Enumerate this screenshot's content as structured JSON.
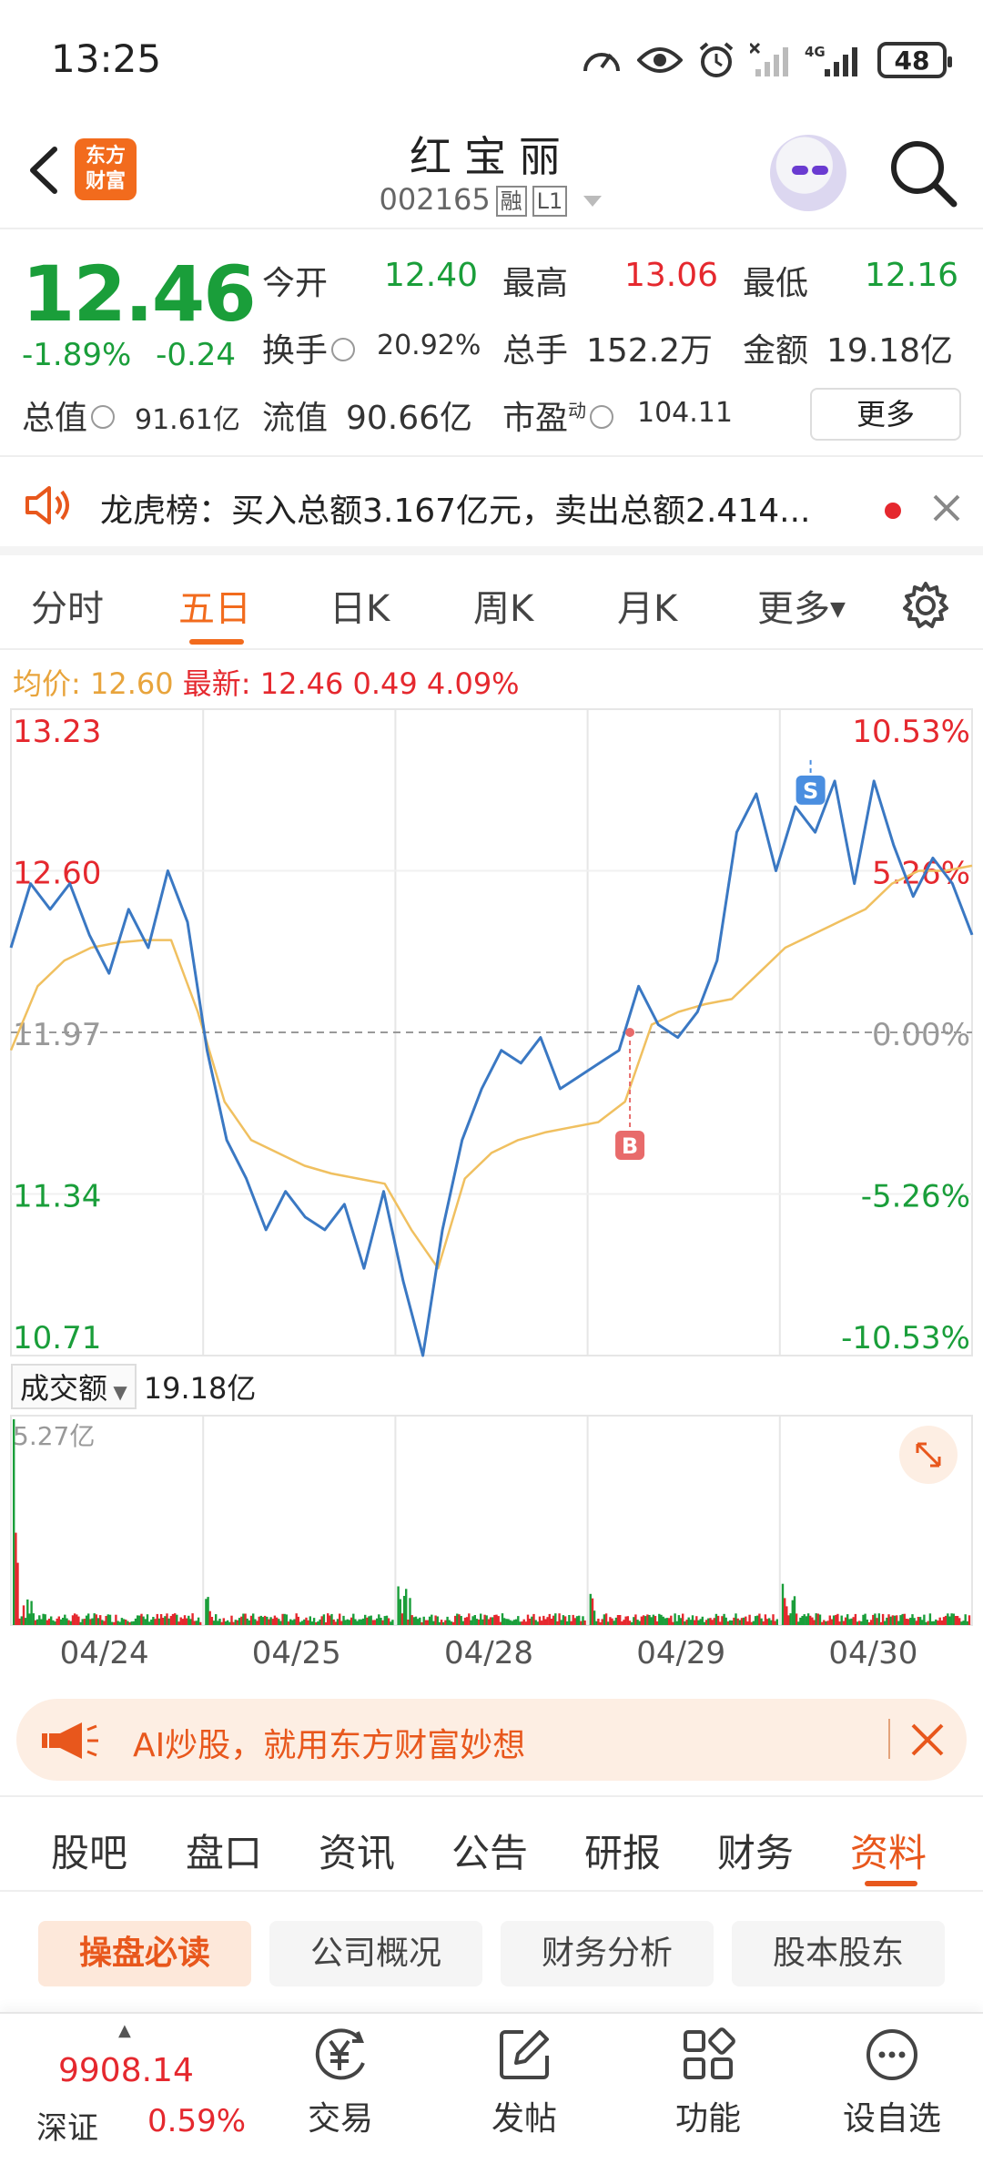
{
  "status_bar": {
    "time": "13:25",
    "battery": "48",
    "network": "4G"
  },
  "header": {
    "stock_name": "红宝丽",
    "stock_code": "002165",
    "tag_margin": "融",
    "tag_level": "L1",
    "logo_line1": "东方",
    "logo_line2": "财富"
  },
  "quote": {
    "price": "12.46",
    "change_pct": "-1.89%",
    "change": "-0.24",
    "open_label": "今开",
    "open": "12.40",
    "high_label": "最高",
    "high": "13.06",
    "low_label": "最低",
    "low": "12.16",
    "turnover_label": "换手",
    "turnover": "20.92%",
    "volume_label": "总手",
    "volume": "152.2万",
    "amount_label": "金额",
    "amount": "19.18亿",
    "mcap_label": "总值",
    "mcap": "91.61亿",
    "float_label": "流值",
    "float_cap": "90.66亿",
    "pe_label": "市盈",
    "pe_sup": "动",
    "pe": "104.11",
    "more": "更多"
  },
  "notice": {
    "text": "龙虎榜：买入总额3.167亿元，卖出总额2.414..."
  },
  "chart_tabs": [
    "分时",
    "五日",
    "日K",
    "周K",
    "月K",
    "更多"
  ],
  "chart_header": {
    "avg_label": "均价:",
    "avg": "12.60",
    "latest_label": "最新:",
    "latest": "12.46",
    "diff": "0.49",
    "diff_pct": "4.09%"
  },
  "chart_data": {
    "type": "line",
    "title": "",
    "xlabel": "",
    "ylabel": "",
    "categories": [
      "04/24",
      "04/25",
      "04/28",
      "04/29",
      "04/30"
    ],
    "y_left_ticks": [
      "13.23",
      "12.60",
      "11.97",
      "11.34",
      "10.71"
    ],
    "y_right_ticks": [
      "10.53%",
      "5.26%",
      "0.00%",
      "-5.26%",
      "-10.53%"
    ],
    "ylim": [
      10.71,
      13.23
    ],
    "prev_close": 11.97,
    "series": [
      {
        "values": [
          12.3,
          12.55,
          12.45,
          12.55,
          12.35,
          12.2,
          12.45,
          12.3,
          12.6,
          12.4,
          11.9,
          11.55,
          11.4,
          11.2,
          11.35,
          11.25,
          11.2,
          11.3,
          11.05,
          11.35,
          11.0,
          10.71,
          11.2,
          11.55,
          11.75,
          11.9,
          11.85,
          11.95,
          11.75,
          11.8,
          11.85,
          11.9,
          12.15,
          12.0,
          11.95,
          12.05,
          12.25,
          12.75,
          12.9,
          12.6,
          12.85,
          12.75,
          12.95,
          12.55,
          12.95,
          12.7,
          12.5,
          12.65,
          12.55,
          12.35
        ]
      },
      {
        "values": [
          11.9,
          12.15,
          12.25,
          12.3,
          12.32,
          12.33,
          12.33,
          12.05,
          11.7,
          11.55,
          11.5,
          11.45,
          11.42,
          11.4,
          11.38,
          11.2,
          11.05,
          11.4,
          11.5,
          11.55,
          11.58,
          11.6,
          11.62,
          11.7,
          12.0,
          12.05,
          12.08,
          12.1,
          12.2,
          12.3,
          12.35,
          12.4,
          12.45,
          12.55,
          12.6,
          12.6,
          12.62
        ]
      }
    ],
    "markers": [
      {
        "label": "B",
        "category": "04/29",
        "price": 11.97
      },
      {
        "label": "S",
        "category": "04/30",
        "price": 12.95
      }
    ],
    "volume_label": "成交额",
    "volume_total": "19.18亿",
    "volume_max": "5.27亿"
  },
  "ad": {
    "text": "AI炒股，就用东方财富妙想"
  },
  "bottom_tabs": [
    "股吧",
    "盘口",
    "资讯",
    "公告",
    "研报",
    "财务",
    "资料"
  ],
  "pills": [
    "操盘必读",
    "公司概况",
    "财务分析",
    "股本股东"
  ],
  "bottom_nav": {
    "index_value": "9908.14",
    "index_name": "深证",
    "index_pct": "0.59%",
    "items": [
      "交易",
      "发帖",
      "功能",
      "设自选"
    ]
  },
  "colors": {
    "up": "#e5282e",
    "down": "#1a9e3a",
    "accent": "#f26b1d",
    "line": "#3a78c3",
    "avg": "#f0c060"
  }
}
